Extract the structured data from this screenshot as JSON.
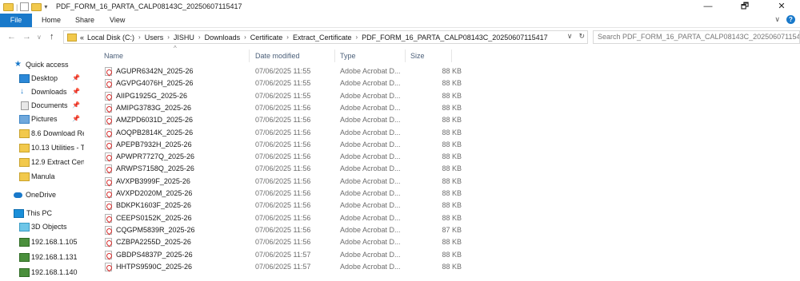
{
  "window": {
    "title": "PDF_FORM_16_PARTA_CALP08143C_20250607115417",
    "controls": {
      "minimize": "—",
      "maximize": "🗗",
      "close": "✕"
    }
  },
  "ribbon": {
    "tabs": {
      "file": "File",
      "home": "Home",
      "share": "Share",
      "view": "View"
    },
    "expand": "∨",
    "help": "?"
  },
  "nav": {
    "back": "←",
    "forward": "→",
    "recent": "∨",
    "up": "↑"
  },
  "address": {
    "overflow": "«",
    "crumbs": [
      "Local Disk (C:)",
      "Users",
      "JISHU",
      "Downloads",
      "Certificate",
      "Extract_Certificate",
      "PDF_FORM_16_PARTA_CALP08143C_20250607115417"
    ],
    "separator": "›",
    "dropdown": "∨",
    "refresh": "↻"
  },
  "search": {
    "placeholder": "Search PDF_FORM_16_PARTA_CALP08143C_2025060711541..."
  },
  "navpane": {
    "quick_access": "Quick access",
    "pinned": [
      {
        "label": "Desktop",
        "pin": "📌"
      },
      {
        "label": "Downloads",
        "pin": "📌"
      },
      {
        "label": "Documents",
        "pin": "📌"
      },
      {
        "label": "Pictures",
        "pin": "📌"
      }
    ],
    "folders": [
      "8.6 Download Re",
      "10.13 Utilities - T",
      "12.9 Extract Cert",
      "Manula"
    ],
    "onedrive": "OneDrive",
    "this_pc": "This PC",
    "objects3d": "3D Objects",
    "network": [
      "192.168.1.105",
      "192.168.1.131",
      "192.168.1.140"
    ]
  },
  "columns": {
    "name": "Name",
    "date": "Date modified",
    "type": "Type",
    "size": "Size",
    "sort_indicator": "^"
  },
  "files": [
    {
      "name": "AGUPR6342N_2025-26",
      "date": "07/06/2025 11:55",
      "type": "Adobe Acrobat D...",
      "size": "88 KB"
    },
    {
      "name": "AGVPG4076H_2025-26",
      "date": "07/06/2025 11:55",
      "type": "Adobe Acrobat D...",
      "size": "88 KB"
    },
    {
      "name": "AIIPG1925G_2025-26",
      "date": "07/06/2025 11:55",
      "type": "Adobe Acrobat D...",
      "size": "88 KB"
    },
    {
      "name": "AMIPG3783G_2025-26",
      "date": "07/06/2025 11:56",
      "type": "Adobe Acrobat D...",
      "size": "88 KB"
    },
    {
      "name": "AMZPD6031D_2025-26",
      "date": "07/06/2025 11:56",
      "type": "Adobe Acrobat D...",
      "size": "88 KB"
    },
    {
      "name": "AOQPB2814K_2025-26",
      "date": "07/06/2025 11:56",
      "type": "Adobe Acrobat D...",
      "size": "88 KB"
    },
    {
      "name": "APEPB7932H_2025-26",
      "date": "07/06/2025 11:56",
      "type": "Adobe Acrobat D...",
      "size": "88 KB"
    },
    {
      "name": "APWPR7727Q_2025-26",
      "date": "07/06/2025 11:56",
      "type": "Adobe Acrobat D...",
      "size": "88 KB"
    },
    {
      "name": "ARWPS7158Q_2025-26",
      "date": "07/06/2025 11:56",
      "type": "Adobe Acrobat D...",
      "size": "88 KB"
    },
    {
      "name": "AVXPB3999F_2025-26",
      "date": "07/06/2025 11:56",
      "type": "Adobe Acrobat D...",
      "size": "88 KB"
    },
    {
      "name": "AVXPD2020M_2025-26",
      "date": "07/06/2025 11:56",
      "type": "Adobe Acrobat D...",
      "size": "88 KB"
    },
    {
      "name": "BDKPK1603F_2025-26",
      "date": "07/06/2025 11:56",
      "type": "Adobe Acrobat D...",
      "size": "88 KB"
    },
    {
      "name": "CEEPS0152K_2025-26",
      "date": "07/06/2025 11:56",
      "type": "Adobe Acrobat D...",
      "size": "88 KB"
    },
    {
      "name": "CQGPM5839R_2025-26",
      "date": "07/06/2025 11:56",
      "type": "Adobe Acrobat D...",
      "size": "87 KB"
    },
    {
      "name": "CZBPA2255D_2025-26",
      "date": "07/06/2025 11:56",
      "type": "Adobe Acrobat D...",
      "size": "88 KB"
    },
    {
      "name": "GBDPS4837P_2025-26",
      "date": "07/06/2025 11:57",
      "type": "Adobe Acrobat D...",
      "size": "88 KB"
    },
    {
      "name": "HHTPS9590C_2025-26",
      "date": "07/06/2025 11:57",
      "type": "Adobe Acrobat D...",
      "size": "88 KB"
    }
  ],
  "colors": {
    "accent": "#1979ca",
    "folder": "#f2c94c",
    "header_text": "#4c607a",
    "pdf_red": "#d62b2b"
  }
}
